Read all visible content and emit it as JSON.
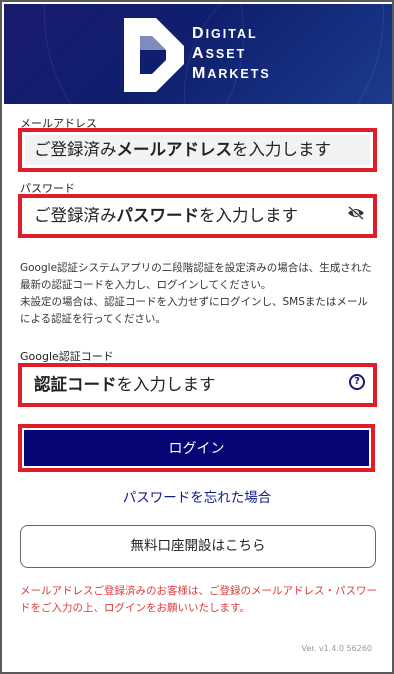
{
  "brand": {
    "line1_cap": "D",
    "line1_rest": "IGITAL",
    "line2_cap": "A",
    "line2_rest": "SSET",
    "line3_cap": "M",
    "line3_rest": "ARKETS",
    "logo_icon": "d-shape-logo-icon"
  },
  "email": {
    "label": "メールアドレス",
    "placeholder_pre": "ご登録済み",
    "placeholder_bold": "メールアドレス",
    "placeholder_post": "を入力します"
  },
  "password": {
    "label": "パスワード",
    "placeholder_pre": "ご登録済み",
    "placeholder_bold": "パスワード",
    "placeholder_post": "を入力します",
    "toggle_icon": "eye-slash-icon"
  },
  "note": {
    "line1": "Google認証システムアプリの二段階認証を設定済みの場合は、生成された最新の認証コードを入力し、ログインしてください。",
    "line2": "未設定の場合は、認証コードを入力せずにログインし、SMSまたはメールによる認証を行ってください。"
  },
  "code": {
    "label": "Google認証コード",
    "placeholder_bold": "認証コード",
    "placeholder_post": "を入力します",
    "help_icon": "question-circle-icon",
    "help_glyph": "?"
  },
  "actions": {
    "login_label": "ログイン",
    "forgot_label": "パスワードを忘れた場合",
    "open_account_label": "無料口座開設はこちら"
  },
  "warning": "メールアドレスご登録済みのお客様は、ご登録のメールアドレス・パスワードをご入力の上、ログインをお願いいたします。",
  "version": "Ver. v1.4.0 56260",
  "colors": {
    "header_bg": "#0f1f6d",
    "highlight_border": "#e01e2a",
    "login_bg": "#050575",
    "link": "#141a8a",
    "warning": "#e03a3a"
  }
}
